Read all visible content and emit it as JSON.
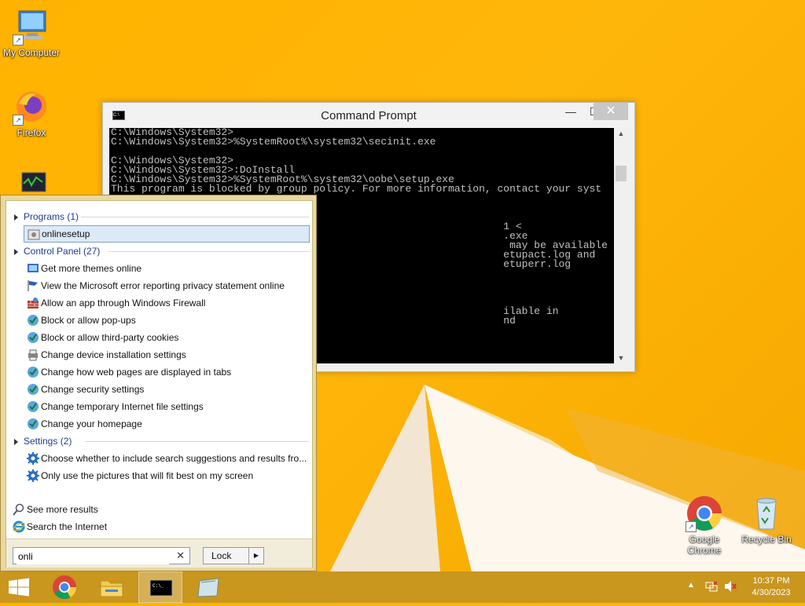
{
  "desktop": {
    "icons": [
      {
        "label": "My Computer"
      },
      {
        "label": "Firefox"
      },
      {
        "label": "Google Chrome"
      },
      {
        "label": "Recycle Bin"
      }
    ]
  },
  "cmd_window": {
    "title": "Command Prompt",
    "lines": [
      "C:\\Windows\\System32>",
      "C:\\Windows\\System32>%SystemRoot%\\system32\\secinit.exe",
      "",
      "C:\\Windows\\System32>",
      "C:\\Windows\\System32>:DoInstall",
      "C:\\Windows\\System32>%SystemRoot%\\system32\\oobe\\setup.exe",
      "This program is blocked by group policy. For more information, contact your syst",
      "",
      "",
      "",
      "                                                                1 <",
      "                                                                .exe",
      "                                                                 may be available in",
      "                                                                etupact.log and",
      "                                                                etuperr.log",
      "",
      "",
      "",
      "",
      "                                                                ilable in",
      "                                                                nd"
    ]
  },
  "search_panel": {
    "groups": [
      {
        "header": "Programs (1)",
        "items": [
          "onlinesetup"
        ]
      },
      {
        "header": "Control Panel (27)",
        "items": [
          "Get more themes online",
          "View the Microsoft error reporting privacy statement online",
          "Allow an app through Windows Firewall",
          "Block or allow pop-ups",
          "Block or allow third-party cookies",
          "Change device installation settings",
          "Change how web pages are displayed in tabs",
          "Change security settings",
          "Change temporary Internet file settings",
          "Change your homepage"
        ]
      },
      {
        "header": "Settings (2)",
        "items": [
          "Choose whether to include search suggestions and results fro...",
          "Only use the pictures that will fit best on my screen"
        ]
      }
    ],
    "see_more": "See more results",
    "search_internet": "Search the Internet",
    "search_value": "onli",
    "lock_label": "Lock"
  },
  "taskbar": {
    "time": "10:37 PM",
    "date": "4/30/2023"
  },
  "colors": {
    "wallpaper": "#ffb300",
    "header_text": "#1e3c8c",
    "selection": "#dce9f7",
    "taskbar": "#c9961e"
  }
}
